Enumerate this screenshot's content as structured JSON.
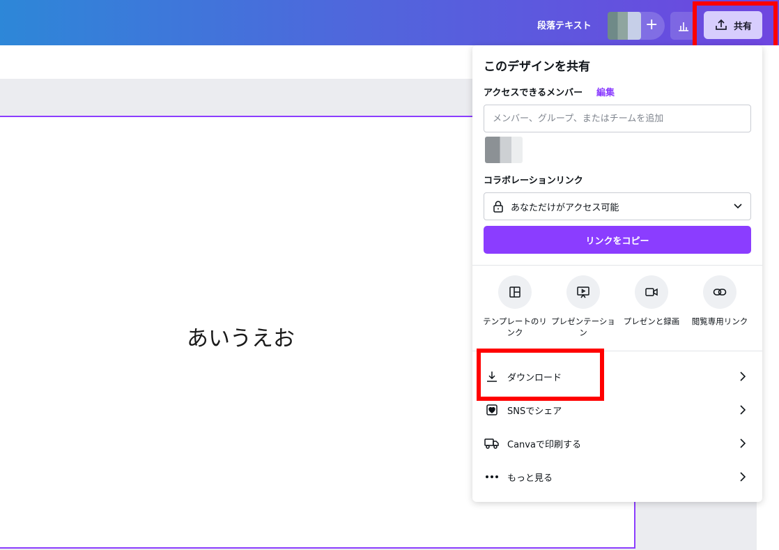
{
  "header": {
    "paragraph_text_label": "段落テキスト",
    "share_button_label": "共有"
  },
  "canvas": {
    "page_text": "あいうえお"
  },
  "share_panel": {
    "title": "このデザインを共有",
    "access_members_label": "アクセスできるメンバー",
    "edit_link": "編集",
    "member_input_placeholder": "メンバー、グループ、またはチームを追加",
    "collab_link_label": "コラボレーションリンク",
    "access_level": "あなただけがアクセス可能",
    "copy_link_button": "リンクをコピー",
    "options": [
      {
        "label": "テンプレートのリンク",
        "icon": "template-icon"
      },
      {
        "label": "プレゼンテーション",
        "icon": "presentation-icon"
      },
      {
        "label": "プレゼンと録画",
        "icon": "video-record-icon"
      },
      {
        "label": "閲覧専用リンク",
        "icon": "link-icon"
      }
    ],
    "rows": [
      {
        "label": "ダウンロード",
        "icon": "download-icon"
      },
      {
        "label": "SNSでシェア",
        "icon": "heart-icon"
      },
      {
        "label": "Canvaで印刷する",
        "icon": "truck-icon"
      },
      {
        "label": "もっと見る",
        "icon": "more-icon"
      }
    ]
  },
  "colors": {
    "accent": "#8b3dff",
    "highlight": "#ff0000"
  }
}
